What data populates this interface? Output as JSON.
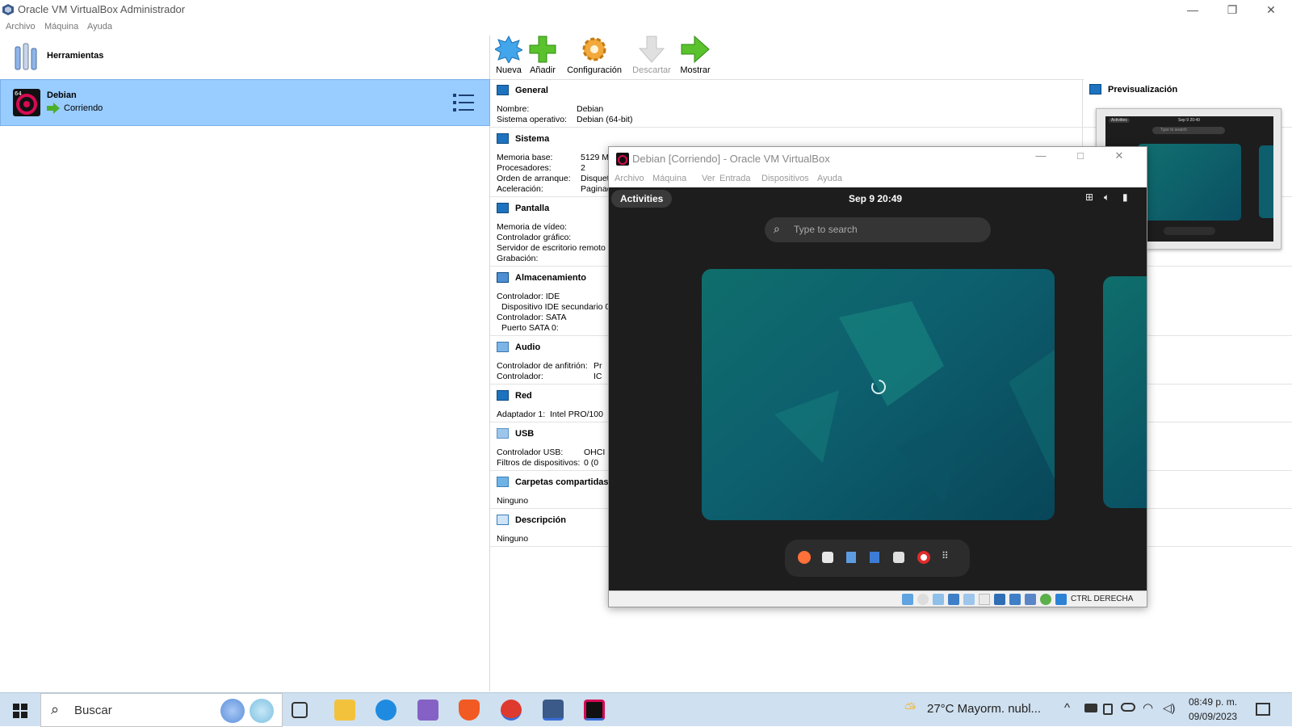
{
  "window": {
    "title": "Oracle VM VirtualBox Administrador",
    "controls": {
      "minimize": "—",
      "restore": "❐",
      "close": "✕"
    }
  },
  "menu": [
    "Archivo",
    "Máquina",
    "Ayuda"
  ],
  "tools": {
    "label": "Herramientas"
  },
  "vm_entry": {
    "name": "Debian",
    "status": "Corriendo"
  },
  "toolbar": {
    "nueva": "Nueva",
    "anadir": "Añadir",
    "configuracion": "Configuración",
    "descartar": "Descartar",
    "mostrar": "Mostrar"
  },
  "details": {
    "general": {
      "title": "General",
      "rows": [
        {
          "k": "Nombre:",
          "v": "Debian"
        },
        {
          "k": "Sistema operativo:",
          "v": "Debian (64-bit)"
        }
      ]
    },
    "sistema": {
      "title": "Sistema",
      "rows": [
        {
          "k": "Memoria base:",
          "v": "5129 M"
        },
        {
          "k": "Procesadores:",
          "v": "2"
        },
        {
          "k": "Orden de arranque:",
          "v": "Disquet"
        },
        {
          "k": "Aceleración:",
          "v": "Paginad"
        }
      ]
    },
    "pantalla": {
      "title": "Pantalla",
      "rows": [
        "Memoria de vídeo:",
        "Controlador gráfico:",
        "Servidor de escritorio remoto",
        "Grabación:"
      ]
    },
    "almacenamiento": {
      "title": "Almacenamiento",
      "rows": [
        "Controlador: IDE",
        "  Dispositivo IDE secundario 0",
        "Controlador: SATA",
        "  Puerto SATA 0:"
      ]
    },
    "audio": {
      "title": "Audio",
      "rows": [
        {
          "k": "Controlador de anfitrión:",
          "v": "Pr"
        },
        {
          "k": "Controlador:",
          "v": "IC"
        }
      ]
    },
    "red": {
      "title": "Red",
      "rows": [
        {
          "k": "Adaptador 1:",
          "v": "Intel PRO/100"
        }
      ]
    },
    "usb": {
      "title": "USB",
      "rows": [
        {
          "k": "Controlador USB:",
          "v": "OHCI"
        },
        {
          "k": "Filtros de dispositivos:",
          "v": "0 (0"
        }
      ]
    },
    "carpetas": {
      "title": "Carpetas compartidas",
      "rows": [
        "Ninguno"
      ]
    },
    "descripcion": {
      "title": "Descripción",
      "rows": [
        "Ninguno"
      ]
    }
  },
  "preview": {
    "title": "Previsualización",
    "clock": "Sep 9  20:49",
    "activities": "Activities",
    "search": "Type to search"
  },
  "vm_window": {
    "title": "Debian [Corriendo] - Oracle VM VirtualBox",
    "menu": [
      "Archivo",
      "Máquina",
      "Ver",
      "Entrada",
      "Dispositivos",
      "Ayuda"
    ],
    "guest": {
      "activities": "Activities",
      "clock": "Sep 9  20:49",
      "search_placeholder": "Type to search"
    },
    "host_key": "CTRL DERECHA"
  },
  "taskbar": {
    "search_placeholder": "Buscar",
    "weather": "27°C  Mayorm. nubl...",
    "time": "08:49 p. m.",
    "date": "09/09/2023"
  },
  "colors": {
    "selected_row": "#99ccff",
    "accent_blue": "#1e73be",
    "guest_bg": "#1d1d1d",
    "wallpaper": "#0d5f6e",
    "taskbar": "#cfe0f0"
  }
}
